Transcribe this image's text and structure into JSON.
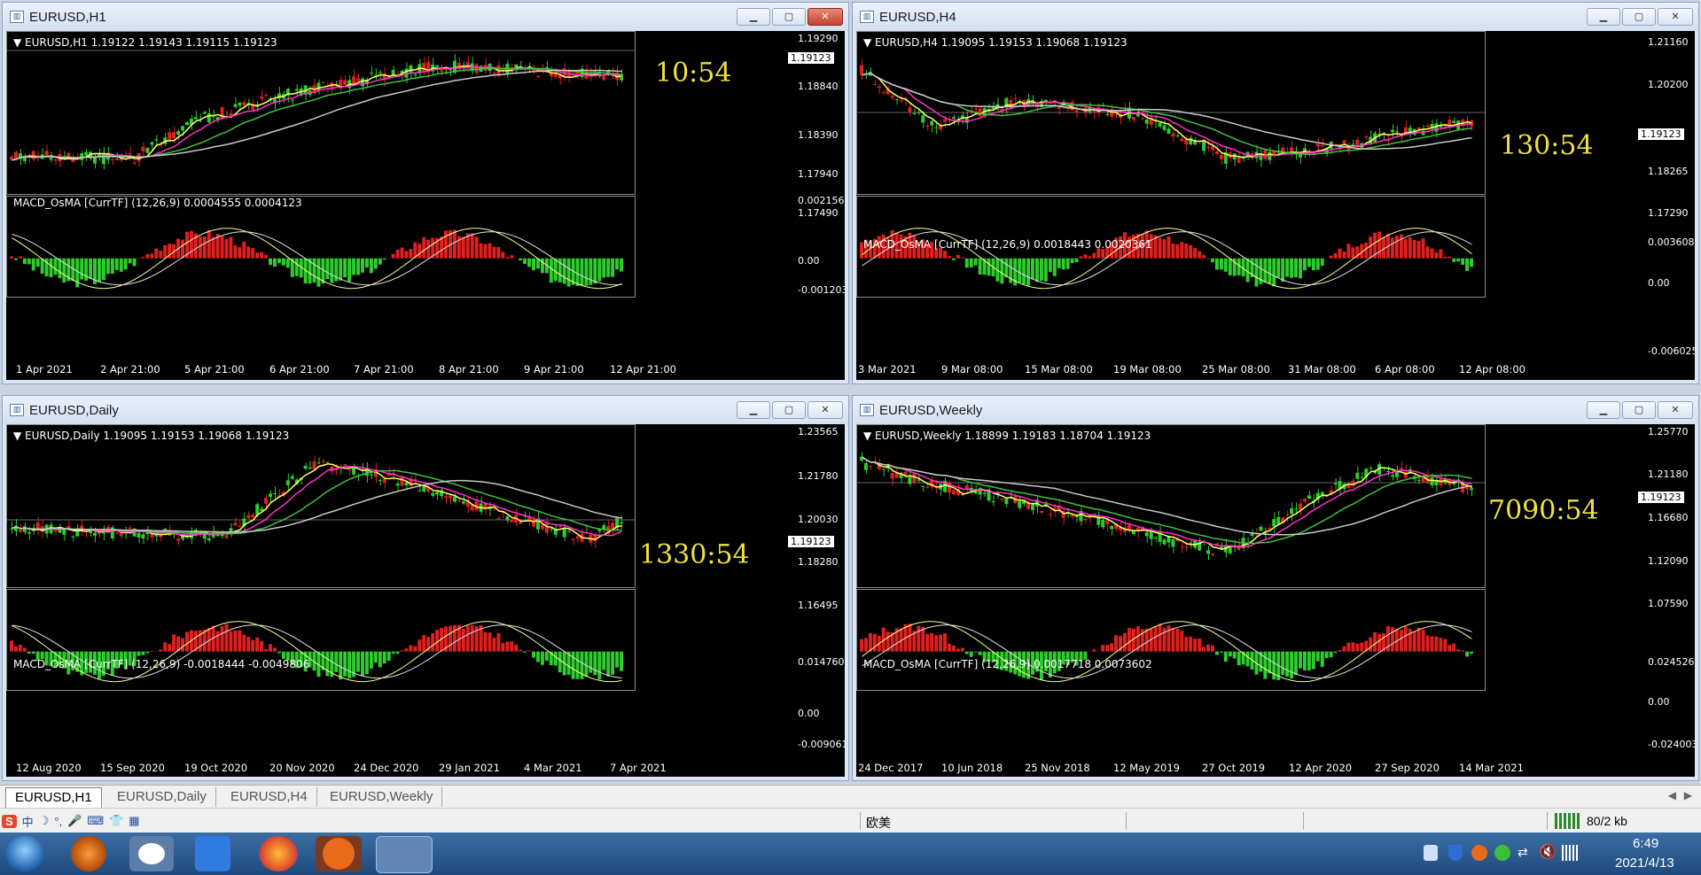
{
  "windows": [
    {
      "id": "h1",
      "title": "EURUSD,H1",
      "ohlc": "EURUSD,H1  1.19122 1.19143 1.19115 1.19123",
      "timer": "10:54",
      "prices": [
        "1.19290",
        "1.19123",
        "1.18840",
        "1.18390",
        "1.17940",
        "1.17490"
      ],
      "macd_label": "MACD_OsMA [CurrTF] (12,26,9) 0.0004555 0.0004123",
      "macd_scale": [
        "0.0021561",
        "0.00",
        "-0.0012032"
      ],
      "dates": [
        "1 Apr 2021",
        "2 Apr 21:00",
        "5 Apr 21:00",
        "6 Apr 21:00",
        "7 Apr 21:00",
        "8 Apr 21:00",
        "9 Apr 21:00",
        "12 Apr 21:00"
      ]
    },
    {
      "id": "h4",
      "title": "EURUSD,H4",
      "ohlc": "EURUSD,H4  1.19095 1.19153 1.19068 1.19123",
      "timer": "130:54",
      "prices": [
        "1.21160",
        "1.20200",
        "1.19123",
        "1.18265",
        "1.17290"
      ],
      "macd_label": "MACD_OsMA [CurrTF] (12,26,9) 0.0018443 0.0020361",
      "macd_scale": [
        "0.0036088",
        "0.00",
        "-0.0060258"
      ],
      "dates": [
        "3 Mar 2021",
        "9 Mar 08:00",
        "15 Mar 08:00",
        "19 Mar 08:00",
        "25 Mar 08:00",
        "31 Mar 08:00",
        "6 Apr 08:00",
        "12 Apr 08:00"
      ]
    },
    {
      "id": "daily",
      "title": "EURUSD,Daily",
      "ohlc": "EURUSD,Daily  1.19095 1.19153 1.19068 1.19123",
      "timer": "1330:54",
      "prices": [
        "1.23565",
        "1.21780",
        "1.20030",
        "1.19123",
        "1.18280",
        "1.16495"
      ],
      "macd_label": "MACD_OsMA [CurrTF] (12,26,9) -0.0018444 -0.0049806",
      "macd_scale": [
        "0.0147607",
        "0.00",
        "-0.0090618"
      ],
      "dates": [
        "12 Aug 2020",
        "15 Sep 2020",
        "19 Oct 2020",
        "20 Nov 2020",
        "24 Dec 2020",
        "29 Jan 2021",
        "4 Mar 2021",
        "7 Apr 2021"
      ]
    },
    {
      "id": "weekly",
      "title": "EURUSD,Weekly",
      "ohlc": "EURUSD,Weekly  1.18899 1.19183 1.18704 1.19123",
      "timer": "7090:54",
      "prices": [
        "1.25770",
        "1.21180",
        "1.19123",
        "1.16680",
        "1.12090",
        "1.07590"
      ],
      "macd_label": "MACD_OsMA [CurrTF] (12,26,9) 0.0017718 0.0073602",
      "macd_scale": [
        "0.0245267",
        "0.00",
        "-0.0240037"
      ],
      "dates": [
        "24 Dec 2017",
        "10 Jun 2018",
        "25 Nov 2018",
        "12 May 2019",
        "27 Oct 2019",
        "12 Apr 2020",
        "27 Sep 2020",
        "14 Mar 2021"
      ]
    }
  ],
  "tabs": [
    "EURUSD,H1",
    "EURUSD,Daily",
    "EURUSD,H4",
    "EURUSD,Weekly"
  ],
  "status": {
    "profile": "欧美",
    "traffic": "80/2 kb"
  },
  "clock": {
    "time": "6:49",
    "date": "2021/4/13"
  },
  "colors": {
    "bull": "#2ecc2e",
    "bear": "#e02020",
    "ma_yellow": "#ffff66",
    "ma_magenta": "#ff2fd0",
    "ma_green": "#40c040",
    "ma_gray": "#c8c8c8",
    "timer": "#f0e040"
  }
}
